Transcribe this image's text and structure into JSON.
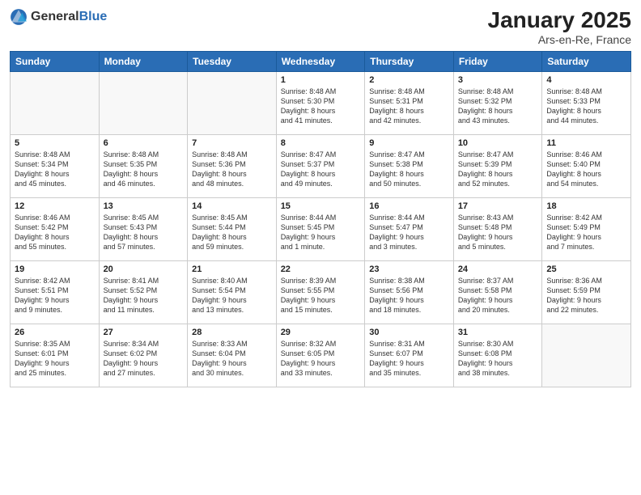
{
  "header": {
    "logo_general": "General",
    "logo_blue": "Blue",
    "month_title": "January 2025",
    "subtitle": "Ars-en-Re, France"
  },
  "weekdays": [
    "Sunday",
    "Monday",
    "Tuesday",
    "Wednesday",
    "Thursday",
    "Friday",
    "Saturday"
  ],
  "weeks": [
    [
      {
        "day": "",
        "info": ""
      },
      {
        "day": "",
        "info": ""
      },
      {
        "day": "",
        "info": ""
      },
      {
        "day": "1",
        "info": "Sunrise: 8:48 AM\nSunset: 5:30 PM\nDaylight: 8 hours\nand 41 minutes."
      },
      {
        "day": "2",
        "info": "Sunrise: 8:48 AM\nSunset: 5:31 PM\nDaylight: 8 hours\nand 42 minutes."
      },
      {
        "day": "3",
        "info": "Sunrise: 8:48 AM\nSunset: 5:32 PM\nDaylight: 8 hours\nand 43 minutes."
      },
      {
        "day": "4",
        "info": "Sunrise: 8:48 AM\nSunset: 5:33 PM\nDaylight: 8 hours\nand 44 minutes."
      }
    ],
    [
      {
        "day": "5",
        "info": "Sunrise: 8:48 AM\nSunset: 5:34 PM\nDaylight: 8 hours\nand 45 minutes."
      },
      {
        "day": "6",
        "info": "Sunrise: 8:48 AM\nSunset: 5:35 PM\nDaylight: 8 hours\nand 46 minutes."
      },
      {
        "day": "7",
        "info": "Sunrise: 8:48 AM\nSunset: 5:36 PM\nDaylight: 8 hours\nand 48 minutes."
      },
      {
        "day": "8",
        "info": "Sunrise: 8:47 AM\nSunset: 5:37 PM\nDaylight: 8 hours\nand 49 minutes."
      },
      {
        "day": "9",
        "info": "Sunrise: 8:47 AM\nSunset: 5:38 PM\nDaylight: 8 hours\nand 50 minutes."
      },
      {
        "day": "10",
        "info": "Sunrise: 8:47 AM\nSunset: 5:39 PM\nDaylight: 8 hours\nand 52 minutes."
      },
      {
        "day": "11",
        "info": "Sunrise: 8:46 AM\nSunset: 5:40 PM\nDaylight: 8 hours\nand 54 minutes."
      }
    ],
    [
      {
        "day": "12",
        "info": "Sunrise: 8:46 AM\nSunset: 5:42 PM\nDaylight: 8 hours\nand 55 minutes."
      },
      {
        "day": "13",
        "info": "Sunrise: 8:45 AM\nSunset: 5:43 PM\nDaylight: 8 hours\nand 57 minutes."
      },
      {
        "day": "14",
        "info": "Sunrise: 8:45 AM\nSunset: 5:44 PM\nDaylight: 8 hours\nand 59 minutes."
      },
      {
        "day": "15",
        "info": "Sunrise: 8:44 AM\nSunset: 5:45 PM\nDaylight: 9 hours\nand 1 minute."
      },
      {
        "day": "16",
        "info": "Sunrise: 8:44 AM\nSunset: 5:47 PM\nDaylight: 9 hours\nand 3 minutes."
      },
      {
        "day": "17",
        "info": "Sunrise: 8:43 AM\nSunset: 5:48 PM\nDaylight: 9 hours\nand 5 minutes."
      },
      {
        "day": "18",
        "info": "Sunrise: 8:42 AM\nSunset: 5:49 PM\nDaylight: 9 hours\nand 7 minutes."
      }
    ],
    [
      {
        "day": "19",
        "info": "Sunrise: 8:42 AM\nSunset: 5:51 PM\nDaylight: 9 hours\nand 9 minutes."
      },
      {
        "day": "20",
        "info": "Sunrise: 8:41 AM\nSunset: 5:52 PM\nDaylight: 9 hours\nand 11 minutes."
      },
      {
        "day": "21",
        "info": "Sunrise: 8:40 AM\nSunset: 5:54 PM\nDaylight: 9 hours\nand 13 minutes."
      },
      {
        "day": "22",
        "info": "Sunrise: 8:39 AM\nSunset: 5:55 PM\nDaylight: 9 hours\nand 15 minutes."
      },
      {
        "day": "23",
        "info": "Sunrise: 8:38 AM\nSunset: 5:56 PM\nDaylight: 9 hours\nand 18 minutes."
      },
      {
        "day": "24",
        "info": "Sunrise: 8:37 AM\nSunset: 5:58 PM\nDaylight: 9 hours\nand 20 minutes."
      },
      {
        "day": "25",
        "info": "Sunrise: 8:36 AM\nSunset: 5:59 PM\nDaylight: 9 hours\nand 22 minutes."
      }
    ],
    [
      {
        "day": "26",
        "info": "Sunrise: 8:35 AM\nSunset: 6:01 PM\nDaylight: 9 hours\nand 25 minutes."
      },
      {
        "day": "27",
        "info": "Sunrise: 8:34 AM\nSunset: 6:02 PM\nDaylight: 9 hours\nand 27 minutes."
      },
      {
        "day": "28",
        "info": "Sunrise: 8:33 AM\nSunset: 6:04 PM\nDaylight: 9 hours\nand 30 minutes."
      },
      {
        "day": "29",
        "info": "Sunrise: 8:32 AM\nSunset: 6:05 PM\nDaylight: 9 hours\nand 33 minutes."
      },
      {
        "day": "30",
        "info": "Sunrise: 8:31 AM\nSunset: 6:07 PM\nDaylight: 9 hours\nand 35 minutes."
      },
      {
        "day": "31",
        "info": "Sunrise: 8:30 AM\nSunset: 6:08 PM\nDaylight: 9 hours\nand 38 minutes."
      },
      {
        "day": "",
        "info": ""
      }
    ]
  ]
}
